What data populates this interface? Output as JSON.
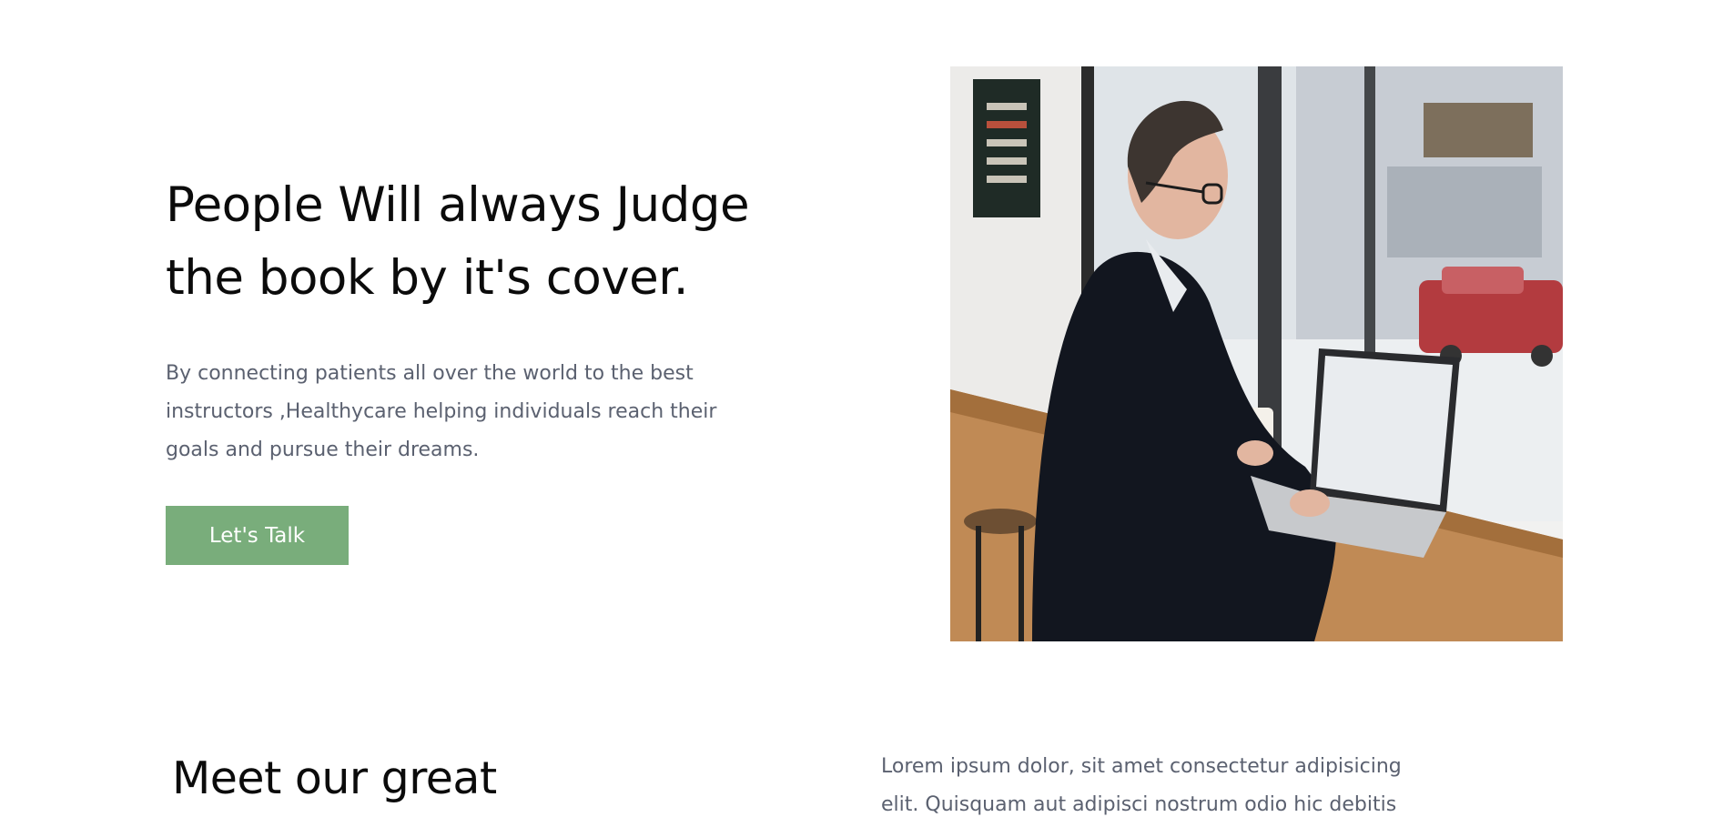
{
  "hero": {
    "title": "People Will always Judge\nthe book by it's cover.",
    "description": "By connecting patients all over the world to the best instructors ,Healthycare helping individuals reach their goals and pursue their dreams.",
    "cta_label": "Let's Talk",
    "cta_color": "#79ad7b"
  },
  "team": {
    "heading": "Meet our great",
    "text": "Lorem ipsum dolor, sit amet consectetur adipisicing elit. Quisquam aut adipisci nostrum odio hic debitis"
  },
  "colors": {
    "heading": "#0b0b0b",
    "body_text": "#5b6170",
    "background": "#ffffff"
  }
}
